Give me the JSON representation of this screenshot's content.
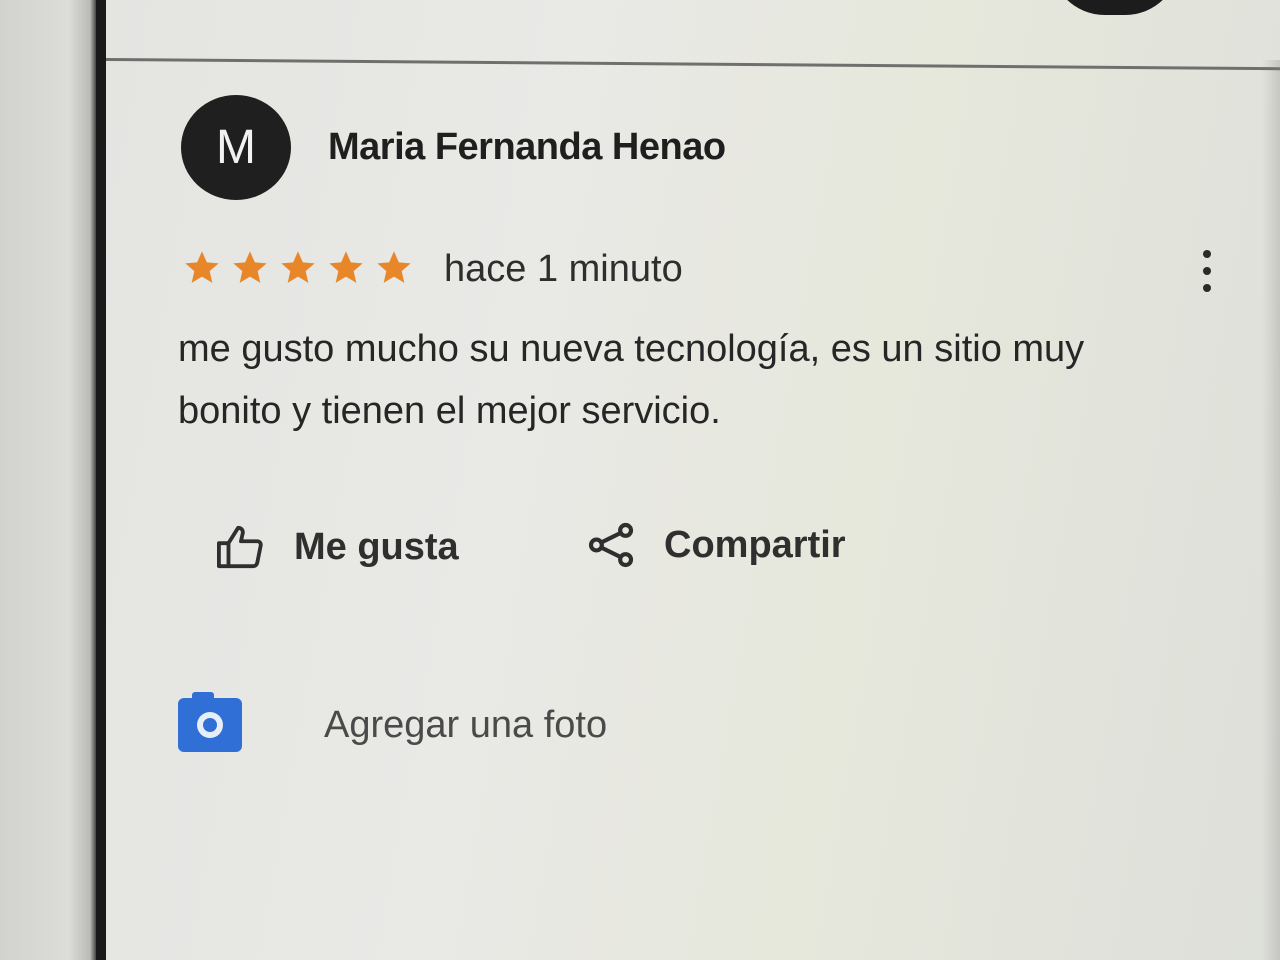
{
  "review": {
    "avatar_initial": "M",
    "author": "Maria Fernanda Henao",
    "rating": 5,
    "max_rating": 5,
    "star_color": "#e8862a",
    "time": "hace 1 minuto",
    "text_line1": "me gusto mucho su nueva tecnología, es un sitio muy",
    "text_line2": "bonito y tienen el mejor servicio."
  },
  "actions": {
    "like_label": "Me gusta",
    "share_label": "Compartir"
  },
  "add_photo": {
    "label": "Agregar una foto",
    "icon_color": "#2f6fd6"
  },
  "icons": {
    "menu": "more-vertical-icon",
    "like": "thumbs-up-icon",
    "share": "share-icon",
    "photo": "camera-icon"
  }
}
